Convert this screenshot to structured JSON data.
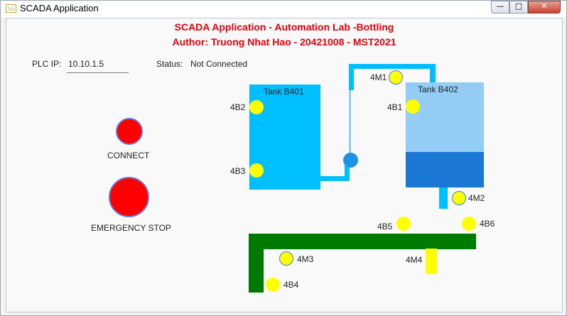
{
  "window": {
    "title": "SCADA Application",
    "icon": "app-icon"
  },
  "header": {
    "title": "SCADA Application - Automation Lab -Bottling",
    "author": "Author: Truong Nhat Hao - 20421008 - MST2021"
  },
  "connection": {
    "plc_ip_label": "PLC IP:",
    "plc_ip_value": "10.10.1.5",
    "status_label": "Status:",
    "status_value": "Not Connected"
  },
  "buttons": {
    "connect_label": "CONNECT",
    "emergency_label": "EMERGENCY STOP"
  },
  "tanks": {
    "b401": {
      "name": "Tank B401"
    },
    "b402": {
      "name": "Tank B402",
      "level": 0.34
    }
  },
  "labels": {
    "s4b2": "4B2",
    "s4b3": "4B3",
    "s4b1": "4B1",
    "m4m1": "4M1",
    "m4m2": "4M2",
    "m4m3": "4M3",
    "m4m4": "4M4",
    "s4b5": "4B5",
    "s4b6": "4B6",
    "s4b4": "4B4"
  },
  "colors": {
    "heading": "#e8000b",
    "button_red": "#ff0000",
    "tank_cyan": "#00bfff",
    "tank_light": "#93ccf5",
    "tank_fill": "#1b77d4",
    "conveyor": "#007a00",
    "indicator_yellow": "#ffff00"
  }
}
